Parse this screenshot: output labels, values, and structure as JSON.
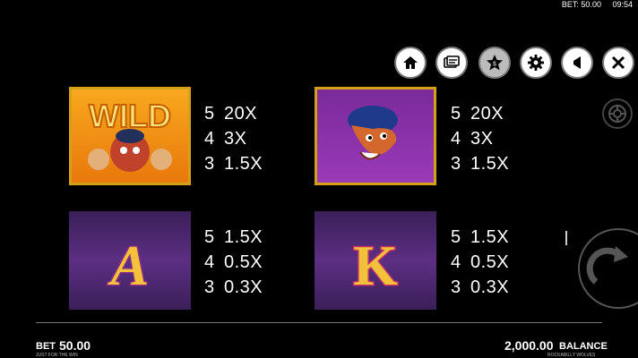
{
  "status_bar": {
    "bet": "BET: 50.00",
    "time": "09:54"
  },
  "toolbar": {
    "icons": [
      "home-icon",
      "paytable-icon",
      "info-star-icon",
      "gear-icon",
      "sound-icon",
      "close-icon"
    ]
  },
  "paytable": [
    {
      "symbol": "WILD",
      "pays": [
        {
          "count": "5",
          "mult": "20X"
        },
        {
          "count": "4",
          "mult": "3X"
        },
        {
          "count": "3",
          "mult": "1.5X"
        }
      ]
    },
    {
      "symbol": "WOLF",
      "pays": [
        {
          "count": "5",
          "mult": "20X"
        },
        {
          "count": "4",
          "mult": "3X"
        },
        {
          "count": "3",
          "mult": "1.5X"
        }
      ]
    },
    {
      "symbol": "A",
      "pays": [
        {
          "count": "5",
          "mult": "1.5X"
        },
        {
          "count": "4",
          "mult": "0.5X"
        },
        {
          "count": "3",
          "mult": "0.3X"
        }
      ]
    },
    {
      "symbol": "K",
      "pays": [
        {
          "count": "5",
          "mult": "1.5X"
        },
        {
          "count": "4",
          "mult": "0.5X"
        },
        {
          "count": "3",
          "mult": "0.3X"
        }
      ]
    }
  ],
  "footer": {
    "bet_label": "BET",
    "bet_value": "50.00",
    "bet_sub": "JUST FOR THE WIN",
    "balance_value": "2,000.00",
    "balance_label": "BALANCE",
    "balance_sub": "ROCKABILLY WOLVES"
  }
}
